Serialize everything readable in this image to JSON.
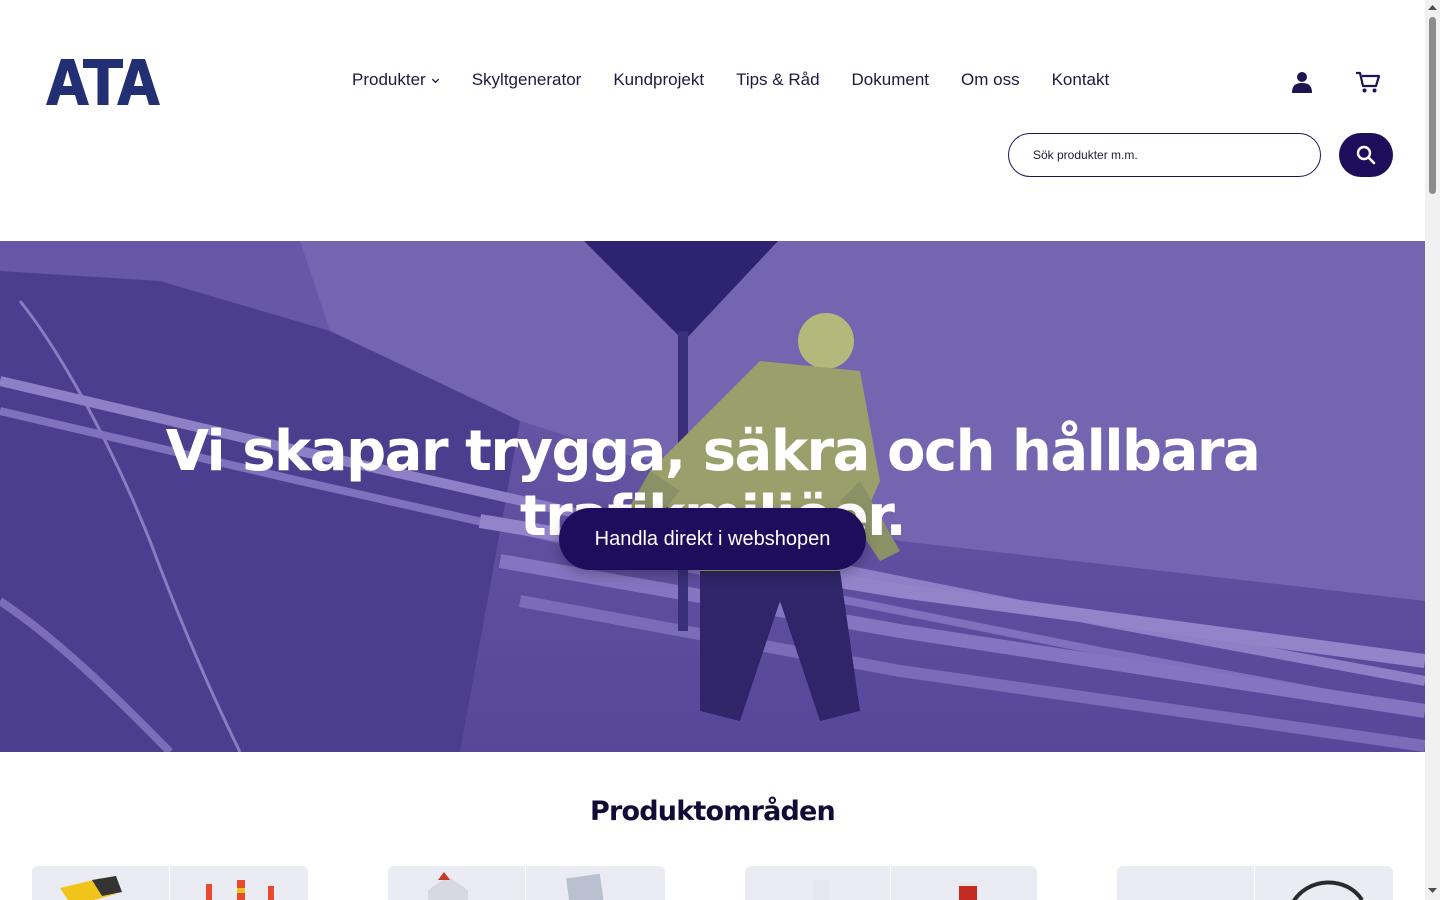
{
  "brand": {
    "logo_text": "ATA",
    "accent": "#1e0d5c",
    "hero_overlay": "#4b3f93"
  },
  "nav": {
    "items": [
      {
        "label": "Produkter",
        "has_dropdown": true
      },
      {
        "label": "Skyltgenerator"
      },
      {
        "label": "Kundprojekt"
      },
      {
        "label": "Tips & Råd"
      },
      {
        "label": "Dokument"
      },
      {
        "label": "Om oss"
      },
      {
        "label": "Kontakt"
      }
    ]
  },
  "header_icons": {
    "account": "user-icon",
    "cart": "cart-icon"
  },
  "search": {
    "placeholder": "Sök produkter m.m.",
    "value": "",
    "button_icon": "search-icon"
  },
  "hero": {
    "title": "Vi skapar trygga, säkra och hållbara trafikmiljöer.",
    "cta_label": "Handla direkt i webshopen"
  },
  "products": {
    "section_title": "Produktområden",
    "cards": [
      {
        "name": "product-area-card-1"
      },
      {
        "name": "product-area-card-2"
      },
      {
        "name": "product-area-card-3"
      },
      {
        "name": "product-area-card-4"
      }
    ]
  }
}
